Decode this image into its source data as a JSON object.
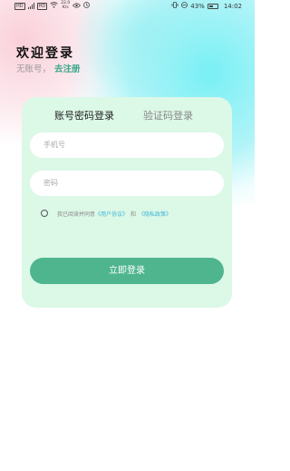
{
  "status_bar": {
    "sim1": "HD",
    "sim2": "HD",
    "signal": "4G",
    "net_speed_value": "22.0",
    "net_speed_unit": "K/s",
    "battery_percent": "43%",
    "time": "14:02"
  },
  "header": {
    "title": "欢迎登录",
    "no_account_text": "无账号，",
    "register_link": "去注册"
  },
  "tabs": {
    "password_login": "账号密码登录",
    "code_login": "验证码登录",
    "active": "password_login"
  },
  "form": {
    "phone_placeholder": "手机号",
    "password_placeholder": "密码",
    "agree_prefix": "我已阅读并同意",
    "user_agreement": "《用户协议》",
    "and_text": "和",
    "privacy_policy": "《隐私政策》",
    "login_button": "立即登录"
  },
  "colors": {
    "accent_green": "#4fb58f",
    "link_green": "#3aa689",
    "link_blue": "#3db5d8",
    "card_background": "#dcf8e7"
  }
}
